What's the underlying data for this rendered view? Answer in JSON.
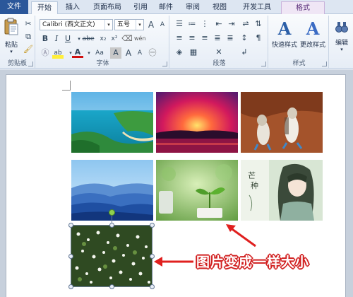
{
  "tabs": {
    "file": "文件",
    "home": "开始",
    "insert": "插入",
    "layout": "页面布局",
    "references": "引用",
    "mailings": "邮件",
    "review": "审阅",
    "view": "视图",
    "developer": "开发工具",
    "format": "格式"
  },
  "clipboard": {
    "paste_label": "粘贴",
    "group_label": "剪贴板"
  },
  "font": {
    "font_name": "Calibri (西文正文)",
    "font_size": "五号",
    "group_label": "字体",
    "bold": "B",
    "italic": "I",
    "underline": "U",
    "strikethrough": "abe",
    "subscript": "x₂",
    "superscript": "x²",
    "font_color_glyph": "A",
    "grow": "A",
    "shrink": "A",
    "highlight_glyph": "ab",
    "char_shading_glyph": "A",
    "change_case_glyph": "Aa",
    "phonetic_glyph": "wén"
  },
  "paragraph": {
    "group_label": "段落"
  },
  "styles": {
    "quick_styles": "快速样式",
    "change_styles": "更改样式",
    "group_label": "样式"
  },
  "editing": {
    "label": "编辑"
  },
  "annotation": {
    "text": "图片变成一样大小"
  }
}
